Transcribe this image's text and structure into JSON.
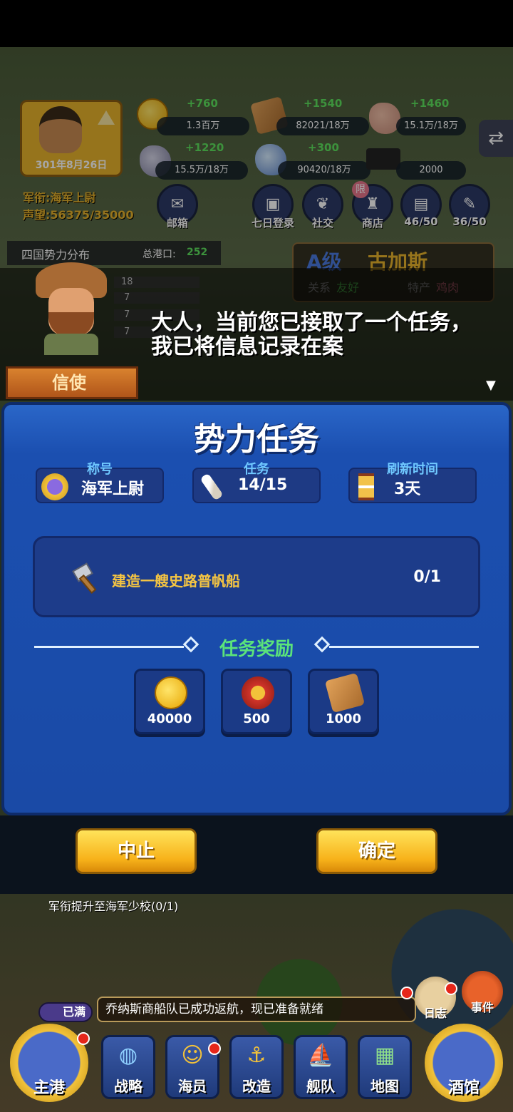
{
  "player": {
    "date": "301年8月26日",
    "rank_line": "军衔:海军上尉",
    "reputation_line": "声望:56375/35000"
  },
  "resources": [
    {
      "icon": "coin-icon",
      "gain": "+760",
      "amount": "1.3百万"
    },
    {
      "icon": "wood-icon",
      "gain": "+1540",
      "amount": "82021/18万"
    },
    {
      "icon": "meat-icon",
      "gain": "+1460",
      "amount": "15.1万/18万"
    },
    {
      "icon": "stone-icon",
      "gain": "+1220",
      "amount": "15.5万/18万"
    },
    {
      "icon": "gem-icon",
      "gain": "+300",
      "amount": "90420/18万"
    },
    {
      "icon": "scholar-hat-icon",
      "gain": "",
      "amount": "2000"
    }
  ],
  "top_menu": [
    {
      "icon": "mail-icon",
      "label": "邮箱"
    },
    {
      "icon": "calendar-icon",
      "label": "七日登录"
    },
    {
      "icon": "laurel-icon",
      "label": "社交"
    },
    {
      "icon": "shop-bag-icon",
      "label": "商店",
      "badge": "限"
    },
    {
      "icon": "book-icon",
      "label": "46/50"
    },
    {
      "icon": "scroll-icon",
      "label": "36/50"
    }
  ],
  "map_info": {
    "four_nations": "四国势力分布",
    "total_ports_label": "总港口:",
    "total_ports_value": "252",
    "bars": [
      "18",
      "7",
      "7",
      "7"
    ],
    "city_grade": "A级",
    "city_name": "古加斯",
    "relation_label": "关系",
    "relation_value": "友好",
    "specialty_label": "特产",
    "specialty_value": "鸡肉"
  },
  "dialog": {
    "speaker": "信使",
    "line1": "大人，当前您已接取了一个任务，",
    "line2": "我已将信息记录在案"
  },
  "panel": {
    "title": "势力任务",
    "info": [
      {
        "label": "称号",
        "value": "海军上尉",
        "icon": "rank-medal-icon"
      },
      {
        "label": "任务",
        "value": "14/15",
        "icon": "scroll-icon"
      },
      {
        "label": "刷新时间",
        "value": "3天",
        "icon": "hourglass-icon"
      }
    ],
    "task": {
      "text": "建造一艘史路普帆船",
      "progress": "0/1"
    },
    "reward_title": "任务奖励",
    "rewards": [
      {
        "icon": "coin-icon",
        "value": "40000"
      },
      {
        "icon": "star-medal-icon",
        "value": "500"
      },
      {
        "icon": "wood-icon",
        "value": "1000"
      }
    ],
    "buttons": {
      "abort": "中止",
      "confirm": "确定"
    }
  },
  "bottom": {
    "quest_tracker": "军衔提升至海军少校(0/1)",
    "full_badge": "已满",
    "notice": "乔纳斯商船队已成功返航，现已准备就绪",
    "log_label": "日志",
    "event_label": "事件",
    "nav": [
      {
        "label": "主港"
      },
      {
        "label": "战略"
      },
      {
        "label": "海员"
      },
      {
        "label": "改造"
      },
      {
        "label": "舰队"
      },
      {
        "label": "地图"
      },
      {
        "label": "酒馆"
      }
    ]
  },
  "colors": {
    "panel_blue": "#1b4fb0",
    "accent_yellow": "#f7b21a",
    "reward_green": "#5be37a",
    "label_cyan": "#6fc8ff"
  }
}
